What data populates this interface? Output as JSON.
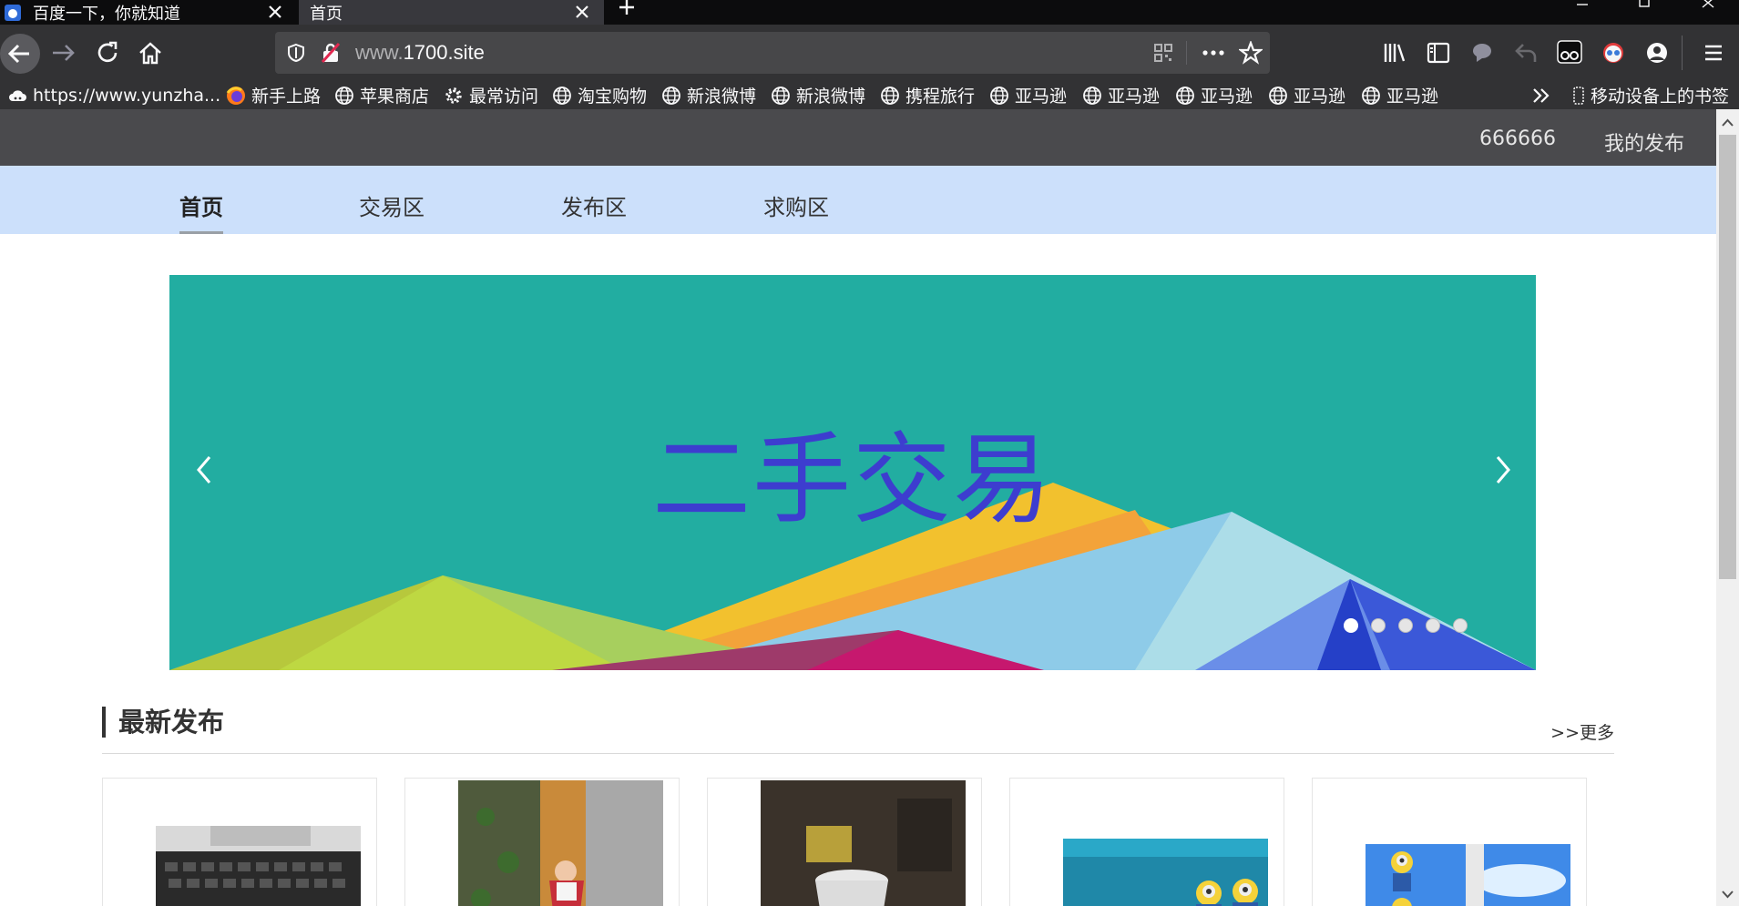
{
  "browser": {
    "tabs": [
      {
        "label": "百度一下，你就知道",
        "active": false
      },
      {
        "label": "首页",
        "active": true
      }
    ],
    "url": {
      "prefix": "www.",
      "domain": "1700.site"
    },
    "bookmarks": [
      {
        "label": "https://www.yunzha...",
        "icon": "cloud-icon"
      },
      {
        "label": "新手上路",
        "icon": "firefox-icon"
      },
      {
        "label": "苹果商店",
        "icon": "globe-icon"
      },
      {
        "label": "最常访问",
        "icon": "gear-icon"
      },
      {
        "label": "淘宝购物",
        "icon": "globe-icon"
      },
      {
        "label": "新浪微博",
        "icon": "globe-icon"
      },
      {
        "label": "新浪微博",
        "icon": "globe-icon"
      },
      {
        "label": "携程旅行",
        "icon": "globe-icon"
      },
      {
        "label": "亚马逊",
        "icon": "globe-icon"
      },
      {
        "label": "亚马逊",
        "icon": "globe-icon"
      },
      {
        "label": "亚马逊",
        "icon": "globe-icon"
      },
      {
        "label": "亚马逊",
        "icon": "globe-icon"
      },
      {
        "label": "亚马逊",
        "icon": "globe-icon"
      }
    ],
    "mobile_bookmarks": "移动设备上的书签"
  },
  "site": {
    "top_links": {
      "user": "666666",
      "my_posts": "我的发布"
    },
    "nav": [
      {
        "label": "首页",
        "active": true
      },
      {
        "label": "交易区",
        "active": false
      },
      {
        "label": "发布区",
        "active": false
      },
      {
        "label": "求购区",
        "active": false
      }
    ],
    "banner": {
      "title": "二手交易",
      "slide_count": 5,
      "active_slide": 1
    },
    "latest": {
      "title": "最新发布",
      "more": ">>更多"
    }
  },
  "colors": {
    "nav_bg": "#cce0fb",
    "banner_bg": "#22ada1",
    "title_color": "#3d3dcf",
    "top_strip": "#4a4a4d"
  }
}
